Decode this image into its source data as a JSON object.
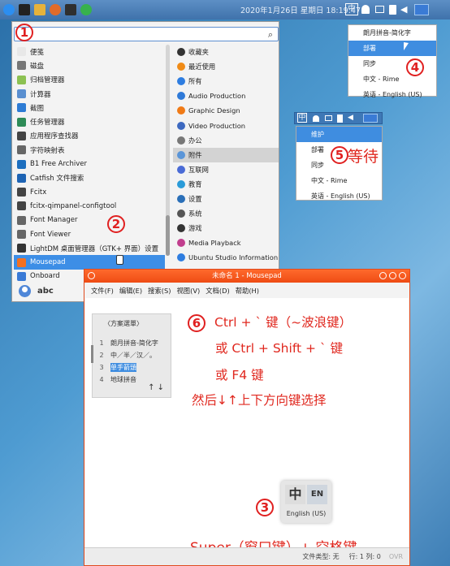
{
  "panel": {
    "clock": "2020年1月26日 星期日 18:19:47",
    "tray": {
      "ime_label": "中"
    }
  },
  "menu": {
    "badge": "1",
    "search": {
      "value": "",
      "placeholder": ""
    },
    "apps": [
      {
        "label": "便笺",
        "color": "#e8e8e8"
      },
      {
        "label": "磁盘",
        "color": "#777777"
      },
      {
        "label": "归档管理器",
        "color": "#8cc152"
      },
      {
        "label": "计算器",
        "color": "#5a8fd0"
      },
      {
        "label": "截图",
        "color": "#2d7bd4"
      },
      {
        "label": "任务管理器",
        "color": "#2e8b57"
      },
      {
        "label": "应用程序查找器",
        "color": "#444444"
      },
      {
        "label": "字符映射表",
        "color": "#666666"
      },
      {
        "label": "B1 Free Archiver",
        "color": "#1d6fbf"
      },
      {
        "label": "Catfish 文件搜索",
        "color": "#1e64b4"
      },
      {
        "label": "Fcitx",
        "color": "#444444"
      },
      {
        "label": "fcitx-qimpanel-configtool",
        "color": "#444444"
      },
      {
        "label": "Font Manager",
        "color": "#666666"
      },
      {
        "label": "Font Viewer",
        "color": "#666666"
      },
      {
        "label": "LightDM 桌面管理器（GTK+ 界面）设置",
        "color": "#333333"
      },
      {
        "label": "Mousepad",
        "color": "#f37021"
      },
      {
        "label": "Onboard",
        "color": "#3a7ad6"
      }
    ],
    "app_badge": "2",
    "categories": [
      {
        "label": "收藏夹",
        "color": "#333333"
      },
      {
        "label": "最近使用",
        "color": "#f08b16"
      },
      {
        "label": "所有",
        "color": "#2e7de0"
      },
      {
        "label": "Audio Production",
        "color": "#2f7ad8"
      },
      {
        "label": "Graphic Design",
        "color": "#f07a16"
      },
      {
        "label": "Video Production",
        "color": "#3d69c0"
      },
      {
        "label": "办公",
        "color": "#777777"
      },
      {
        "label": "附件",
        "color": "#5a95d8"
      },
      {
        "label": "互联网",
        "color": "#4a6bd6"
      },
      {
        "label": "教育",
        "color": "#2a9bd8"
      },
      {
        "label": "设置",
        "color": "#2a6fb8"
      },
      {
        "label": "系统",
        "color": "#555555"
      },
      {
        "label": "游戏",
        "color": "#333333"
      },
      {
        "label": "Media Playback",
        "color": "#c13e8e"
      },
      {
        "label": "Ubuntu Studio Information",
        "color": "#2e7de0"
      }
    ],
    "user": "abc"
  },
  "tray_menu": {
    "badge": "4",
    "items": [
      {
        "label": "朗月拼音-简化字",
        "highlight": false
      },
      {
        "label": "部署",
        "highlight": true
      },
      {
        "label": "同步",
        "highlight": false
      },
      {
        "label": "中文 - Rime",
        "highlight": false
      },
      {
        "label": "英语 - English (US)",
        "highlight": false
      }
    ]
  },
  "tray_menu2": {
    "badge": "5",
    "waiting": "等待",
    "ime_label": "中",
    "items": [
      {
        "label": "维护",
        "highlight": true
      },
      {
        "label": "部署",
        "highlight": false
      },
      {
        "label": "同步",
        "highlight": false
      },
      {
        "label": "中文 - Rime",
        "highlight": false
      },
      {
        "label": "英语 - English (US)",
        "highlight": false
      }
    ]
  },
  "mousepad": {
    "title": "未命名 1 - Mousepad",
    "menus": [
      "文件(F)",
      "编辑(E)",
      "搜索(S)",
      "视图(V)",
      "文档(D)",
      "帮助(H)"
    ],
    "status": {
      "filetype": "文件类型: 无",
      "position": "行: 1 列: 0",
      "ovr": "OVR"
    },
    "ime_popup": {
      "title": "〈方案選單〉",
      "options": [
        {
          "num": "1",
          "label": "朗月拼音-简化字"
        },
        {
          "num": "2",
          "label": "中／半／汉／。"
        },
        {
          "num": "3",
          "label": "单手箭頭"
        },
        {
          "num": "4",
          "label": "地球拼音"
        }
      ],
      "nav": "↑ ↓"
    },
    "instructions": {
      "badge": "6",
      "line1": "Ctrl + ` 键（~波浪键）",
      "line2": "或 Ctrl + Shift + ` 键",
      "line3": "或 F4 键",
      "line4": "然后↓↑上下方向键选择",
      "badge3": "3",
      "switch_left": "中",
      "switch_right": "EN",
      "switch_label": "English (US)",
      "line5": "Super（窗口键）+ 空格键"
    }
  }
}
